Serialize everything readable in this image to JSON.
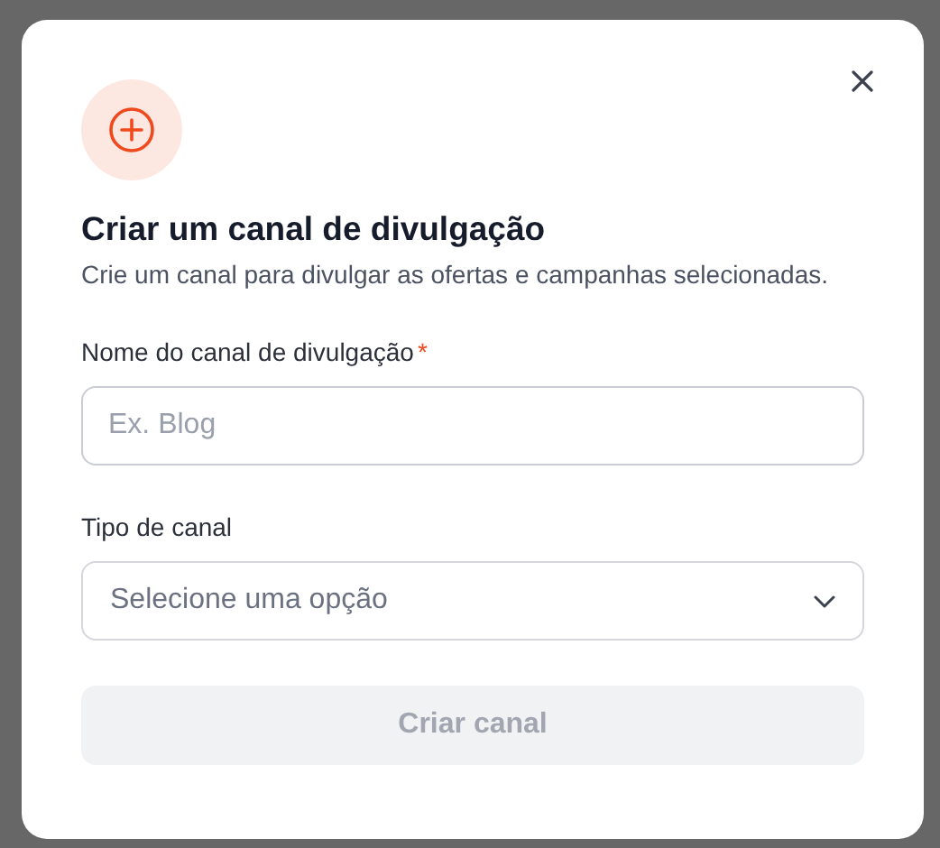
{
  "dialog": {
    "title": "Criar um canal de divulgação",
    "description": "Crie um canal para divulgar as ofertas e campanhas selecionadas.",
    "fields": [
      {
        "kind": "text",
        "label": "Nome do canal de divulgação",
        "required_mark": "*",
        "placeholder": "Ex. Blog"
      },
      {
        "kind": "select",
        "label": "Tipo de canal",
        "placeholder": "Selecione uma opção"
      }
    ],
    "submit": {
      "label": "Criar canal",
      "disabled": true
    }
  }
}
